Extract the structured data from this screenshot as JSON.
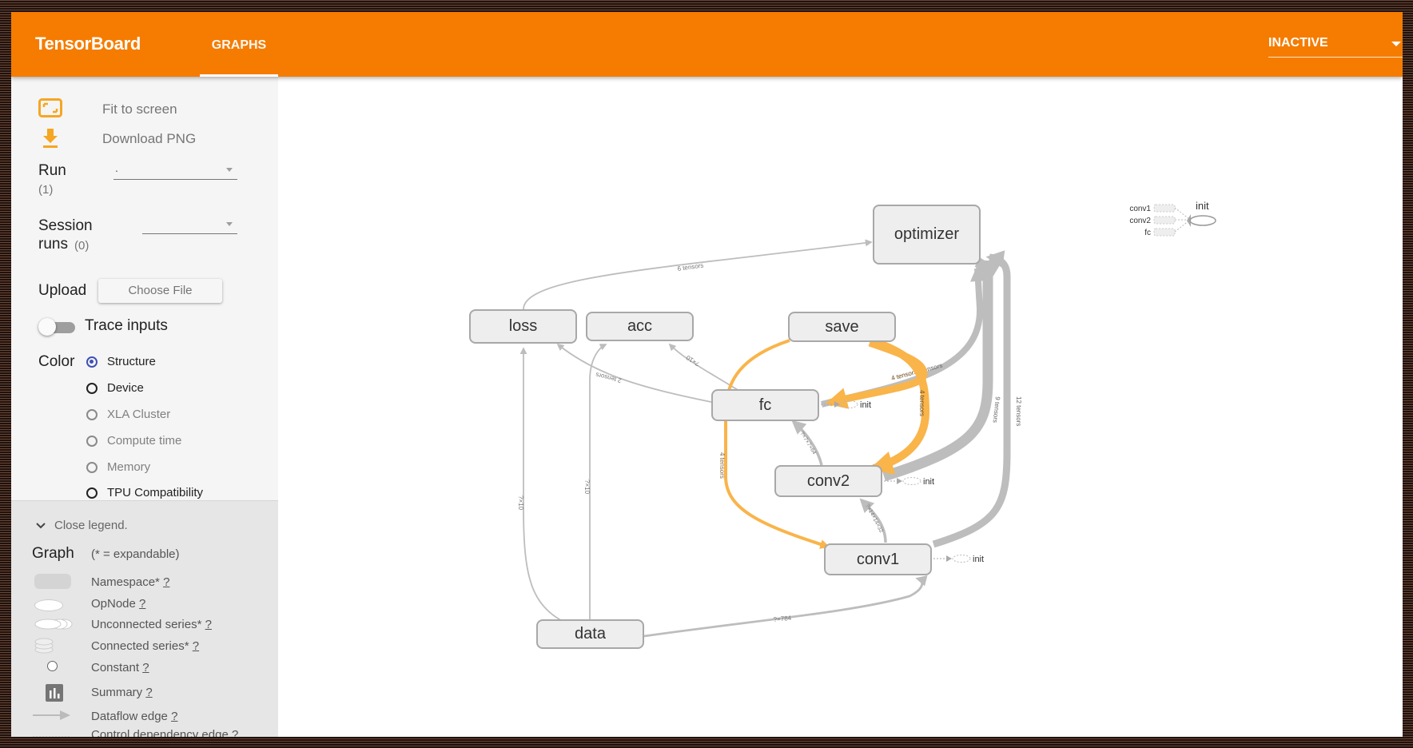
{
  "header": {
    "brand": "TensorBoard",
    "tabs": [
      {
        "label": "GRAPHS",
        "active": true
      }
    ],
    "status_select": {
      "value": "INACTIVE"
    },
    "accent": "#f57c00"
  },
  "sidebar": {
    "fit_to_screen": {
      "label": "Fit to screen",
      "icon": "fit-screen-icon"
    },
    "download_png": {
      "label": "Download PNG",
      "icon": "download-icon"
    },
    "run": {
      "label": "Run",
      "count": "(1)",
      "value": "."
    },
    "session_runs": {
      "label_line1": "Session",
      "label_line2": "runs",
      "count": "(0)",
      "value": ""
    },
    "upload": {
      "label": "Upload",
      "button": "Choose File"
    },
    "trace_inputs": {
      "label": "Trace inputs",
      "on": false
    },
    "color": {
      "label": "Color",
      "options": [
        {
          "label": "Structure",
          "selected": true,
          "enabled": true
        },
        {
          "label": "Device",
          "selected": false,
          "enabled": true
        },
        {
          "label": "XLA Cluster",
          "selected": false,
          "enabled": false
        },
        {
          "label": "Compute time",
          "selected": false,
          "enabled": false
        },
        {
          "label": "Memory",
          "selected": false,
          "enabled": false
        },
        {
          "label": "TPU Compatibility",
          "selected": false,
          "enabled": true
        }
      ]
    }
  },
  "legend": {
    "toggle": "Close legend.",
    "title": "Graph",
    "subtitle": "(* = expandable)",
    "items": [
      {
        "label": "Namespace*",
        "help": "?"
      },
      {
        "label": "OpNode",
        "help": "?"
      },
      {
        "label": "Unconnected series*",
        "help": "?"
      },
      {
        "label": "Connected series*",
        "help": "?"
      },
      {
        "label": "Constant",
        "help": "?"
      },
      {
        "label": "Summary",
        "help": "?"
      },
      {
        "label": "Dataflow edge",
        "help": "?"
      },
      {
        "label": "Control dependency edge",
        "help": "?"
      }
    ]
  },
  "graph": {
    "nodes": {
      "optimizer": "optimizer",
      "loss": "loss",
      "acc": "acc",
      "save": "save",
      "fc": "fc",
      "conv2": "conv2",
      "conv1": "conv1",
      "data": "data"
    },
    "init_label": "init",
    "edge_labels": {
      "loss_optimizer": "6 tensors",
      "fc_loss": "2 tensors",
      "fc_acc": "?×10",
      "data_loss": "?×10",
      "data_acc": "?×10",
      "data_conv1": "?×784",
      "conv1_conv2": "?×14×14×32",
      "conv2_fc": "?×7×7×64",
      "save_fc": "4 tensors",
      "fc_optimizer": "6 tensors",
      "save_conv2": "4 tensors",
      "conv2_optimizer": "9 tensors",
      "conv1_optimizer": "12 tensors",
      "save_conv1": "4 tensors"
    },
    "aux_graph": {
      "inputs": [
        "conv1",
        "conv2",
        "fc"
      ],
      "target": "init"
    },
    "colors": {
      "highlight": "#f9b44a",
      "edge": "#bdbdbd",
      "node_fill": "#eeeeee"
    }
  }
}
